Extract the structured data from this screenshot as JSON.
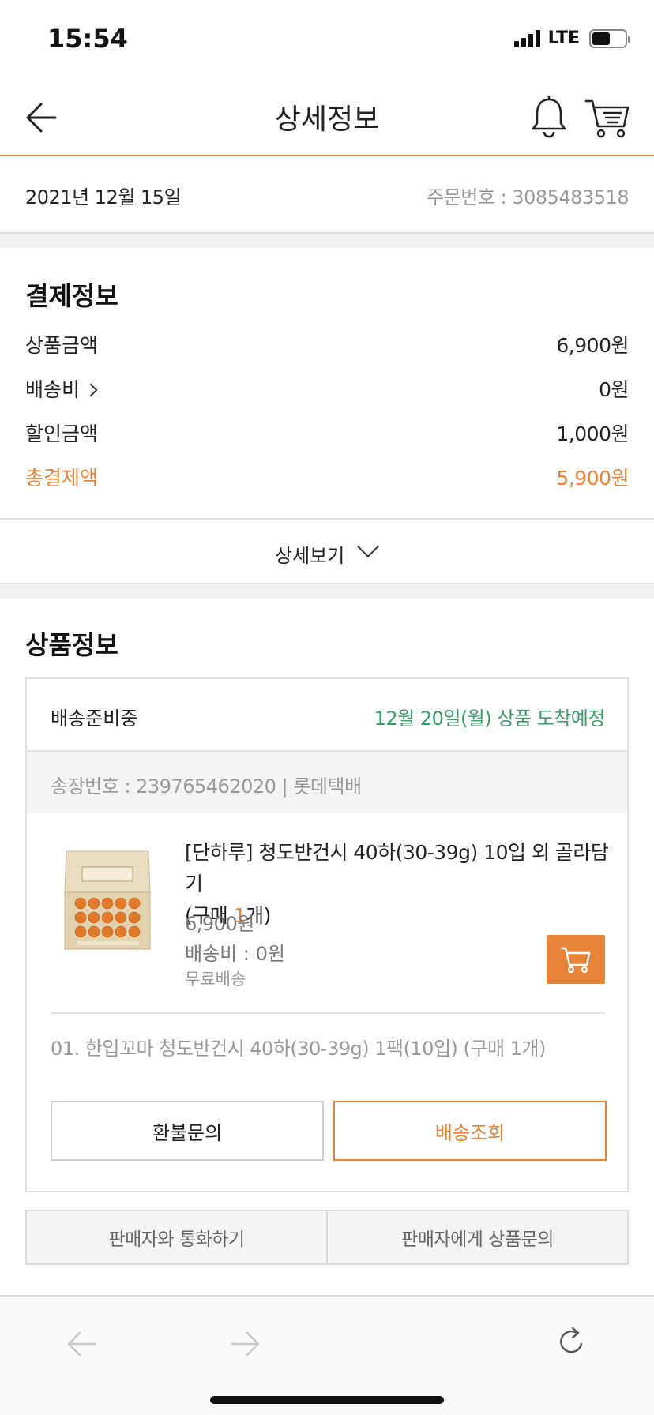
{
  "status_bar": {
    "time": "15:54",
    "network": "LTE"
  },
  "header": {
    "title": "상세정보",
    "icons": [
      "back-arrow-icon",
      "bell-icon",
      "cart-icon"
    ]
  },
  "order": {
    "date": "2021년 12월 15일",
    "order_number": "주문번호 : 3085483518"
  },
  "payment": {
    "title": "결제정보",
    "rows": [
      {
        "label": "상품금액",
        "value": "6,900원"
      },
      {
        "label": "배송비",
        "value": "0원"
      },
      {
        "label": "할인금액",
        "value": "1,000원"
      },
      {
        "label": "총결제액",
        "value": "5,900원"
      }
    ],
    "detail_toggle": "상세보기"
  },
  "product_section": {
    "title": "상품정보",
    "ship_status": "배송준비중",
    "arrival": "12월 20일(월) 상품 도착예정",
    "invoice": "송장번호 : 239765462020 | 롯데택배",
    "item": {
      "name": "[단하루] 청도반건시 40하(30-39g) 10입 외 골라담기",
      "qty_prefix": "(구매 ",
      "qty": "1",
      "qty_suffix": "개)",
      "price": "6,900원",
      "shipping": "배송비 : 0원",
      "free_shipping": "무료배송"
    },
    "option": "01. 한입꼬마 청도반건시 40하(30-39g) 1팩(10입) (구매 1개)",
    "refund_button": "환불문의",
    "track_button": "배송조회"
  },
  "seller": {
    "call_button": "판매자와 통화하기",
    "inquiry_button": "판매자에게 상품문의"
  },
  "colors": {
    "accent": "#e8833a",
    "arrival_green": "#3a9d6a",
    "muted": "#999999"
  }
}
